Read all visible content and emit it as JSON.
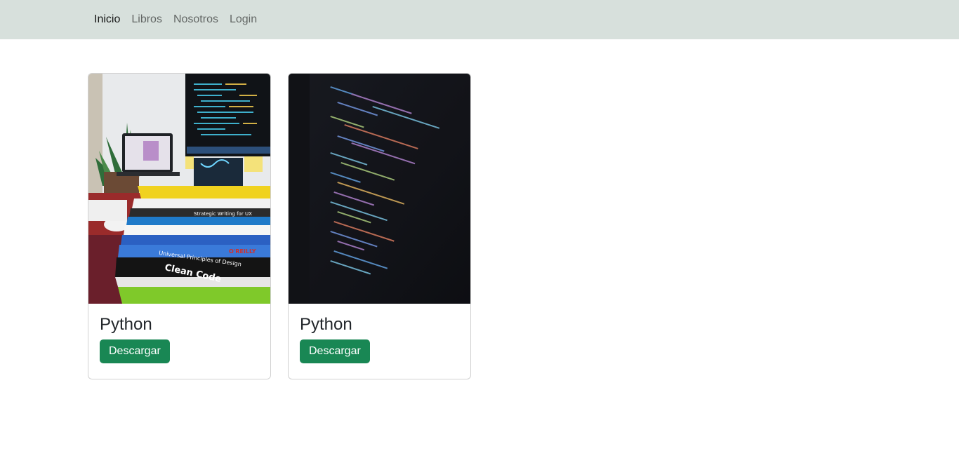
{
  "navbar": {
    "links": [
      {
        "label": "Inicio",
        "active": true
      },
      {
        "label": "Libros",
        "active": false
      },
      {
        "label": "Nosotros",
        "active": false
      },
      {
        "label": "Login",
        "active": false
      }
    ]
  },
  "cards": [
    {
      "title": "Python",
      "button_label": "Descargar",
      "image": "books-desk-photo"
    },
    {
      "title": "Python",
      "button_label": "Descargar",
      "image": "code-screen-photo"
    }
  ],
  "colors": {
    "navbar_bg": "#d7e0dc",
    "button_bg": "#198754"
  }
}
